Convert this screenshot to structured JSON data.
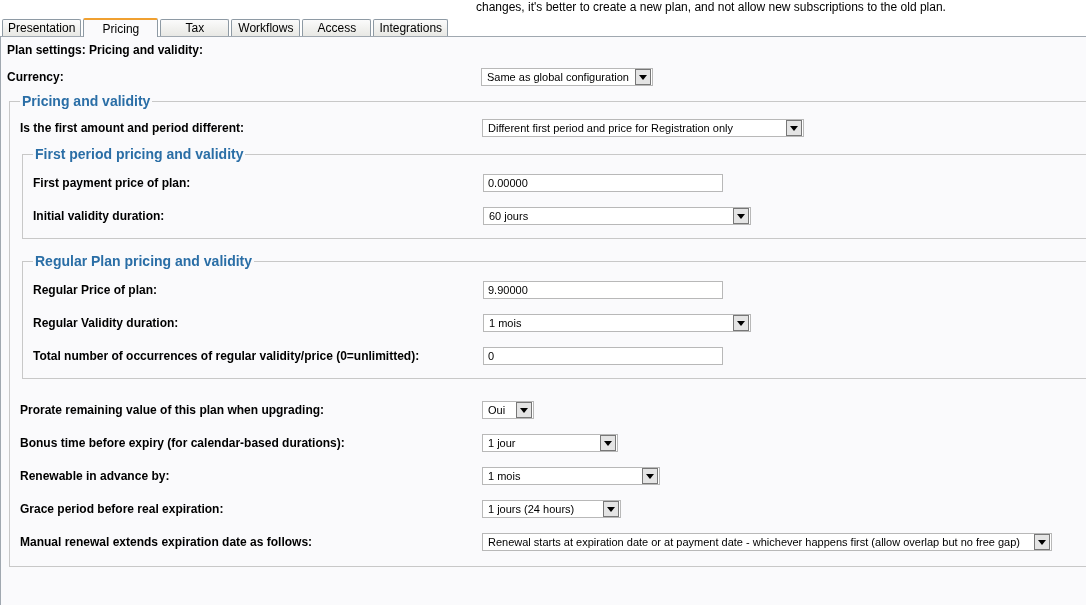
{
  "notice": "changes, it's better to create a new plan, and not allow new subscriptions to the old plan.",
  "tabs": [
    {
      "label": "Presentation",
      "selected": false
    },
    {
      "label": "Pricing",
      "selected": true
    },
    {
      "label": "Tax",
      "selected": false
    },
    {
      "label": "Workflows",
      "selected": false
    },
    {
      "label": "Access",
      "selected": false
    },
    {
      "label": "Integrations",
      "selected": false
    }
  ],
  "heading": "Plan settings: Pricing and validity:",
  "currency": {
    "label": "Currency:",
    "kind": "select",
    "value": "Same as global configuration"
  },
  "pricing_section": {
    "title": "Pricing and validity",
    "rows": [
      {
        "label": "Is the first amount and period different:",
        "kind": "select",
        "value": "Different first period and price for Registration only"
      }
    ],
    "subsections": [
      {
        "title": "First period pricing and validity",
        "rows": [
          {
            "label": "First payment price of plan:",
            "kind": "input",
            "value": "0.00000"
          },
          {
            "label": "Initial validity duration:",
            "kind": "select",
            "value": "60 jours"
          }
        ]
      },
      {
        "title": "Regular Plan pricing and validity",
        "rows": [
          {
            "label": "Regular Price of plan:",
            "kind": "input",
            "value": "9.90000"
          },
          {
            "label": "Regular Validity duration:",
            "kind": "select",
            "value": "1 mois"
          },
          {
            "label": "Total number of occurrences of regular validity/price (0=unlimitted):",
            "kind": "input",
            "value": "0"
          }
        ]
      }
    ],
    "rows_after": [
      {
        "label": "Prorate remaining value of this plan when upgrading:",
        "kind": "select",
        "value": "Oui"
      },
      {
        "label": "Bonus time before expiry (for calendar-based durations):",
        "kind": "select",
        "value": "1 jour"
      },
      {
        "label": "Renewable in advance by:",
        "kind": "select",
        "value": "1 mois"
      },
      {
        "label": "Grace period before real expiration:",
        "kind": "select",
        "value": "1 jours (24 hours)"
      },
      {
        "label": "Manual renewal extends expiration date as follows:",
        "kind": "select",
        "value": "Renewal starts at expiration date or at payment date - whichever happens first (allow overlap but no free gap)"
      }
    ]
  }
}
